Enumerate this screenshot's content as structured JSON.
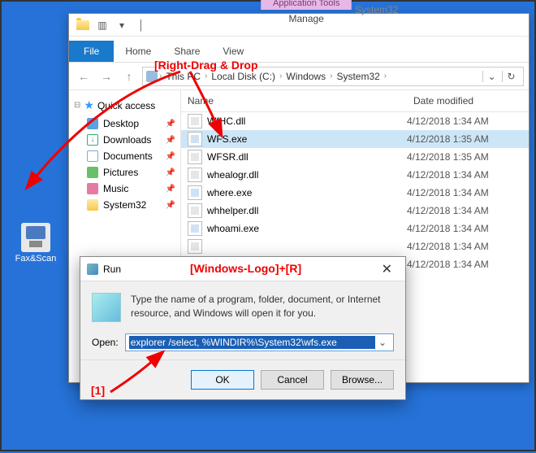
{
  "desktop": {
    "fax_label": "Fax&Scan"
  },
  "explorer": {
    "context_tool_header": "Application Tools",
    "context_tool_tab": "Manage",
    "context_label": "System32",
    "tabs": {
      "file": "File",
      "home": "Home",
      "share": "Share",
      "view": "View"
    },
    "breadcrumb": [
      "This PC",
      "Local Disk (C:)",
      "Windows",
      "System32"
    ],
    "sidebar": {
      "quick_access": "Quick access",
      "items": [
        {
          "label": "Desktop"
        },
        {
          "label": "Downloads"
        },
        {
          "label": "Documents"
        },
        {
          "label": "Pictures"
        },
        {
          "label": "Music"
        },
        {
          "label": "System32"
        }
      ]
    },
    "columns": {
      "name": "Name",
      "date": "Date modified"
    },
    "files": [
      {
        "name": "WfHC.dll",
        "date": "4/12/2018 1:34 AM",
        "type": "dll",
        "selected": false
      },
      {
        "name": "WFS.exe",
        "date": "4/12/2018 1:35 AM",
        "type": "exe",
        "selected": true
      },
      {
        "name": "WFSR.dll",
        "date": "4/12/2018 1:35 AM",
        "type": "dll",
        "selected": false
      },
      {
        "name": "whealogr.dll",
        "date": "4/12/2018 1:34 AM",
        "type": "dll",
        "selected": false
      },
      {
        "name": "where.exe",
        "date": "4/12/2018 1:34 AM",
        "type": "exe",
        "selected": false
      },
      {
        "name": "whhelper.dll",
        "date": "4/12/2018 1:34 AM",
        "type": "dll",
        "selected": false
      },
      {
        "name": "whoami.exe",
        "date": "4/12/2018 1:34 AM",
        "type": "exe",
        "selected": false
      },
      {
        "name": "",
        "date": "4/12/2018 1:34 AM",
        "type": "dll",
        "selected": false
      },
      {
        "name": "",
        "date": "4/12/2018 1:34 AM",
        "type": "dll",
        "selected": false
      }
    ]
  },
  "run": {
    "title": "Run",
    "message": "Type the name of a program, folder, document, or Internet resource, and Windows will open it for you.",
    "open_label": "Open:",
    "open_value": "explorer /select, %WINDIR%\\System32\\wfs.exe",
    "ok": "OK",
    "cancel": "Cancel",
    "browse": "Browse..."
  },
  "annotations": {
    "drag": "[Right-Drag & Drop",
    "winr": "[Windows-Logo]+[R]",
    "one": "[1]"
  }
}
